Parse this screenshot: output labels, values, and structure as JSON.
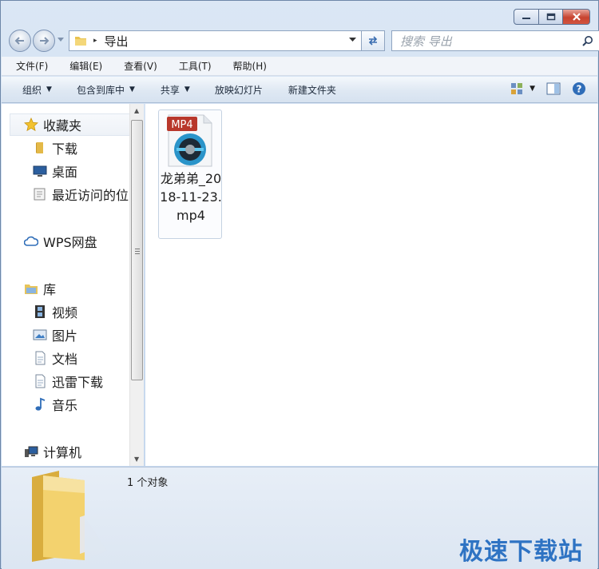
{
  "window": {
    "caption_buttons": [
      "minimize",
      "maximize",
      "close"
    ]
  },
  "address_bar": {
    "current_folder": "导出",
    "separator": "▸"
  },
  "search": {
    "placeholder": "搜索 导出"
  },
  "menu": {
    "items": [
      "文件(F)",
      "编辑(E)",
      "查看(V)",
      "工具(T)",
      "帮助(H)"
    ]
  },
  "command_bar": {
    "items": [
      {
        "label": "组织",
        "has_dropdown": true
      },
      {
        "label": "包含到库中",
        "has_dropdown": true
      },
      {
        "label": "共享",
        "has_dropdown": true
      },
      {
        "label": "放映幻灯片",
        "has_dropdown": false
      },
      {
        "label": "新建文件夹",
        "has_dropdown": false
      }
    ]
  },
  "nav_pane": {
    "favorites": {
      "label": "收藏夹",
      "icon": "star-icon"
    },
    "favorite_items": [
      {
        "label": "下载",
        "icon": "folder-icon"
      },
      {
        "label": "桌面",
        "icon": "desktop-icon"
      },
      {
        "label": "最近访问的位",
        "icon": "recent-places-icon"
      }
    ],
    "wps": {
      "label": "WPS网盘",
      "icon": "cloud-icon"
    },
    "library": {
      "label": "库",
      "icon": "library-icon"
    },
    "library_items": [
      {
        "label": "视频",
        "icon": "video-icon"
      },
      {
        "label": "图片",
        "icon": "picture-icon"
      },
      {
        "label": "文档",
        "icon": "document-icon"
      },
      {
        "label": "迅雷下载",
        "icon": "document-icon"
      },
      {
        "label": "音乐",
        "icon": "music-icon"
      }
    ],
    "computer": {
      "label": "计算机",
      "icon": "computer-icon"
    }
  },
  "content": {
    "files": [
      {
        "name": "龙弟弟_2018-11-23.mp4",
        "type_badge": "MP4",
        "icon": "mp4-video-file-icon"
      }
    ]
  },
  "details": {
    "count_text": "1 个对象"
  },
  "watermark": "极速下载站",
  "colors": {
    "accent": "#2e73c3",
    "mp4_badge": "#c0392b",
    "folder": "#f1cf6a"
  }
}
